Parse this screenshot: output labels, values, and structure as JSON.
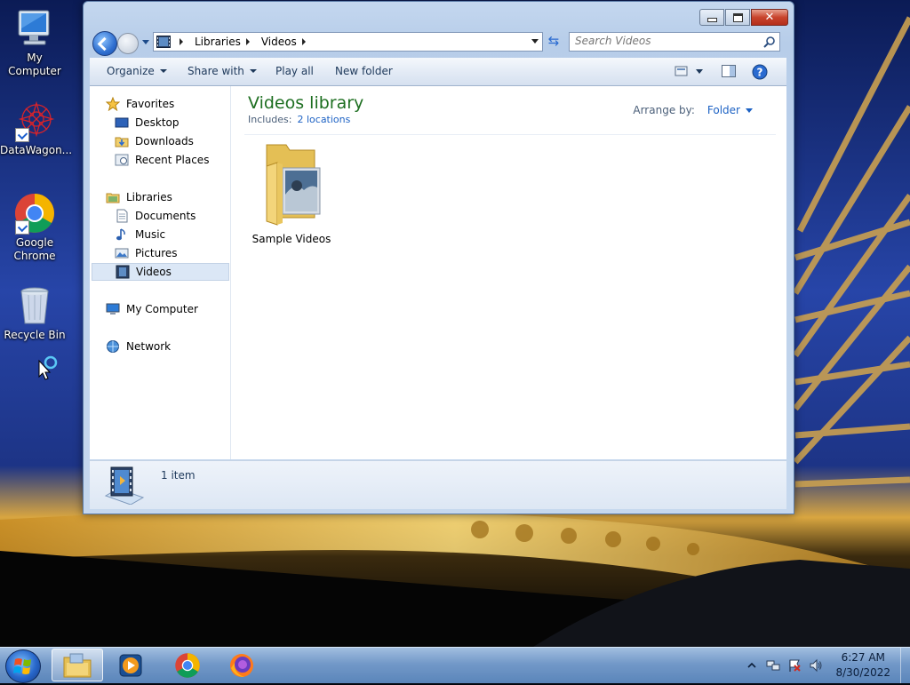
{
  "desktop": {
    "icons": [
      {
        "label": "My Computer"
      },
      {
        "label": "DataWagon..."
      },
      {
        "label": "Google Chrome"
      },
      {
        "label": "Recycle Bin"
      }
    ]
  },
  "window": {
    "address": {
      "crumbs": [
        "Libraries",
        "Videos"
      ],
      "search_placeholder": "Search Videos"
    },
    "toolbar": {
      "organize": "Organize",
      "share_with": "Share with",
      "play_all": "Play all",
      "new_folder": "New folder"
    },
    "nav": {
      "favorites": "Favorites",
      "favorites_items": [
        "Desktop",
        "Downloads",
        "Recent Places"
      ],
      "libraries": "Libraries",
      "libraries_items": [
        "Documents",
        "Music",
        "Pictures",
        "Videos"
      ],
      "selected": "Videos",
      "my_computer": "My Computer",
      "network": "Network"
    },
    "main": {
      "title": "Videos library",
      "includes_label": "Includes:",
      "includes_link": "2 locations",
      "arrange_label": "Arrange by:",
      "arrange_value": "Folder",
      "items": [
        {
          "label": "Sample Videos",
          "type": "folder"
        }
      ]
    },
    "details": {
      "count": "1 item"
    }
  },
  "taskbar": {
    "pinned": [
      "windows-explorer",
      "windows-media-player",
      "google-chrome",
      "firefox"
    ],
    "active": "windows-explorer",
    "clock": {
      "time": "6:27 AM",
      "date": "8/30/2022"
    }
  },
  "colors": {
    "library_title": "#1e6f21",
    "link": "#1d62c4",
    "selection": "#dbe7f6"
  }
}
